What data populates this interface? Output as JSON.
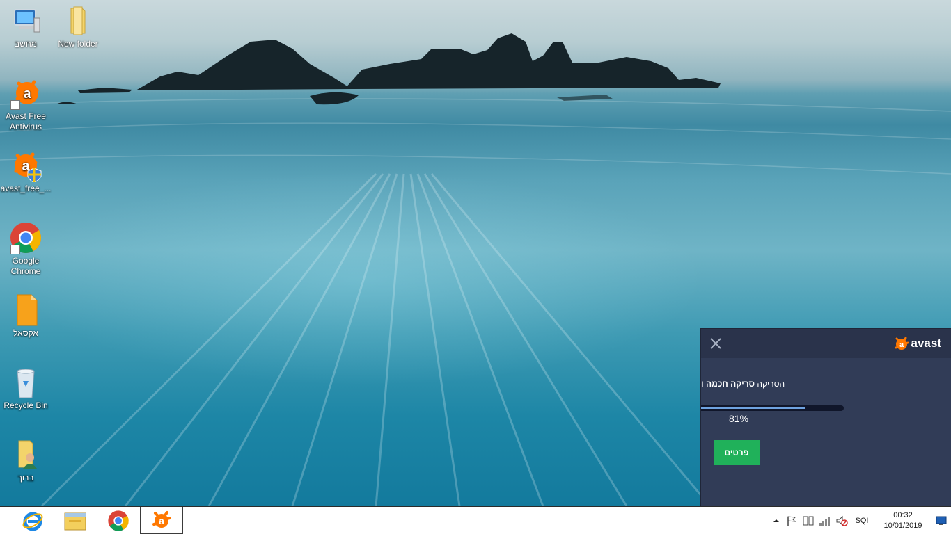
{
  "desktop": {
    "icons": [
      {
        "label": "מחשב",
        "icon": "computer-icon"
      },
      {
        "label": "New folder",
        "icon": "folder-icon"
      },
      {
        "label": "Avast Free Antivirus",
        "icon": "avast-icon"
      },
      {
        "label": "avast_free_...",
        "icon": "avast-installer-icon"
      },
      {
        "label": "Google Chrome",
        "icon": "chrome-icon"
      },
      {
        "label": "אקסאל",
        "icon": "excel-file-icon"
      },
      {
        "label": "Recycle Bin",
        "icon": "recycle-bin-icon"
      },
      {
        "label": "ברוך",
        "icon": "user-folder-icon"
      }
    ]
  },
  "avast_popup": {
    "brand": "avast",
    "scan_prefix": "הסריקה",
    "scan_name": "סריקה חכמה ו",
    "progress_percent": 81,
    "progress_label": "81%",
    "details_button": "פרטים",
    "brand_color": "#ff7800",
    "button_color": "#20b15a"
  },
  "taskbar": {
    "pinned": [
      {
        "name": "internet-explorer",
        "icon": "ie-icon"
      },
      {
        "name": "file-explorer",
        "icon": "file-explorer-icon"
      },
      {
        "name": "google-chrome",
        "icon": "chrome-icon"
      },
      {
        "name": "avast",
        "icon": "avast-icon"
      }
    ],
    "tray": {
      "language": "SQI",
      "time": "00:32",
      "date": "10/01/2019"
    }
  }
}
